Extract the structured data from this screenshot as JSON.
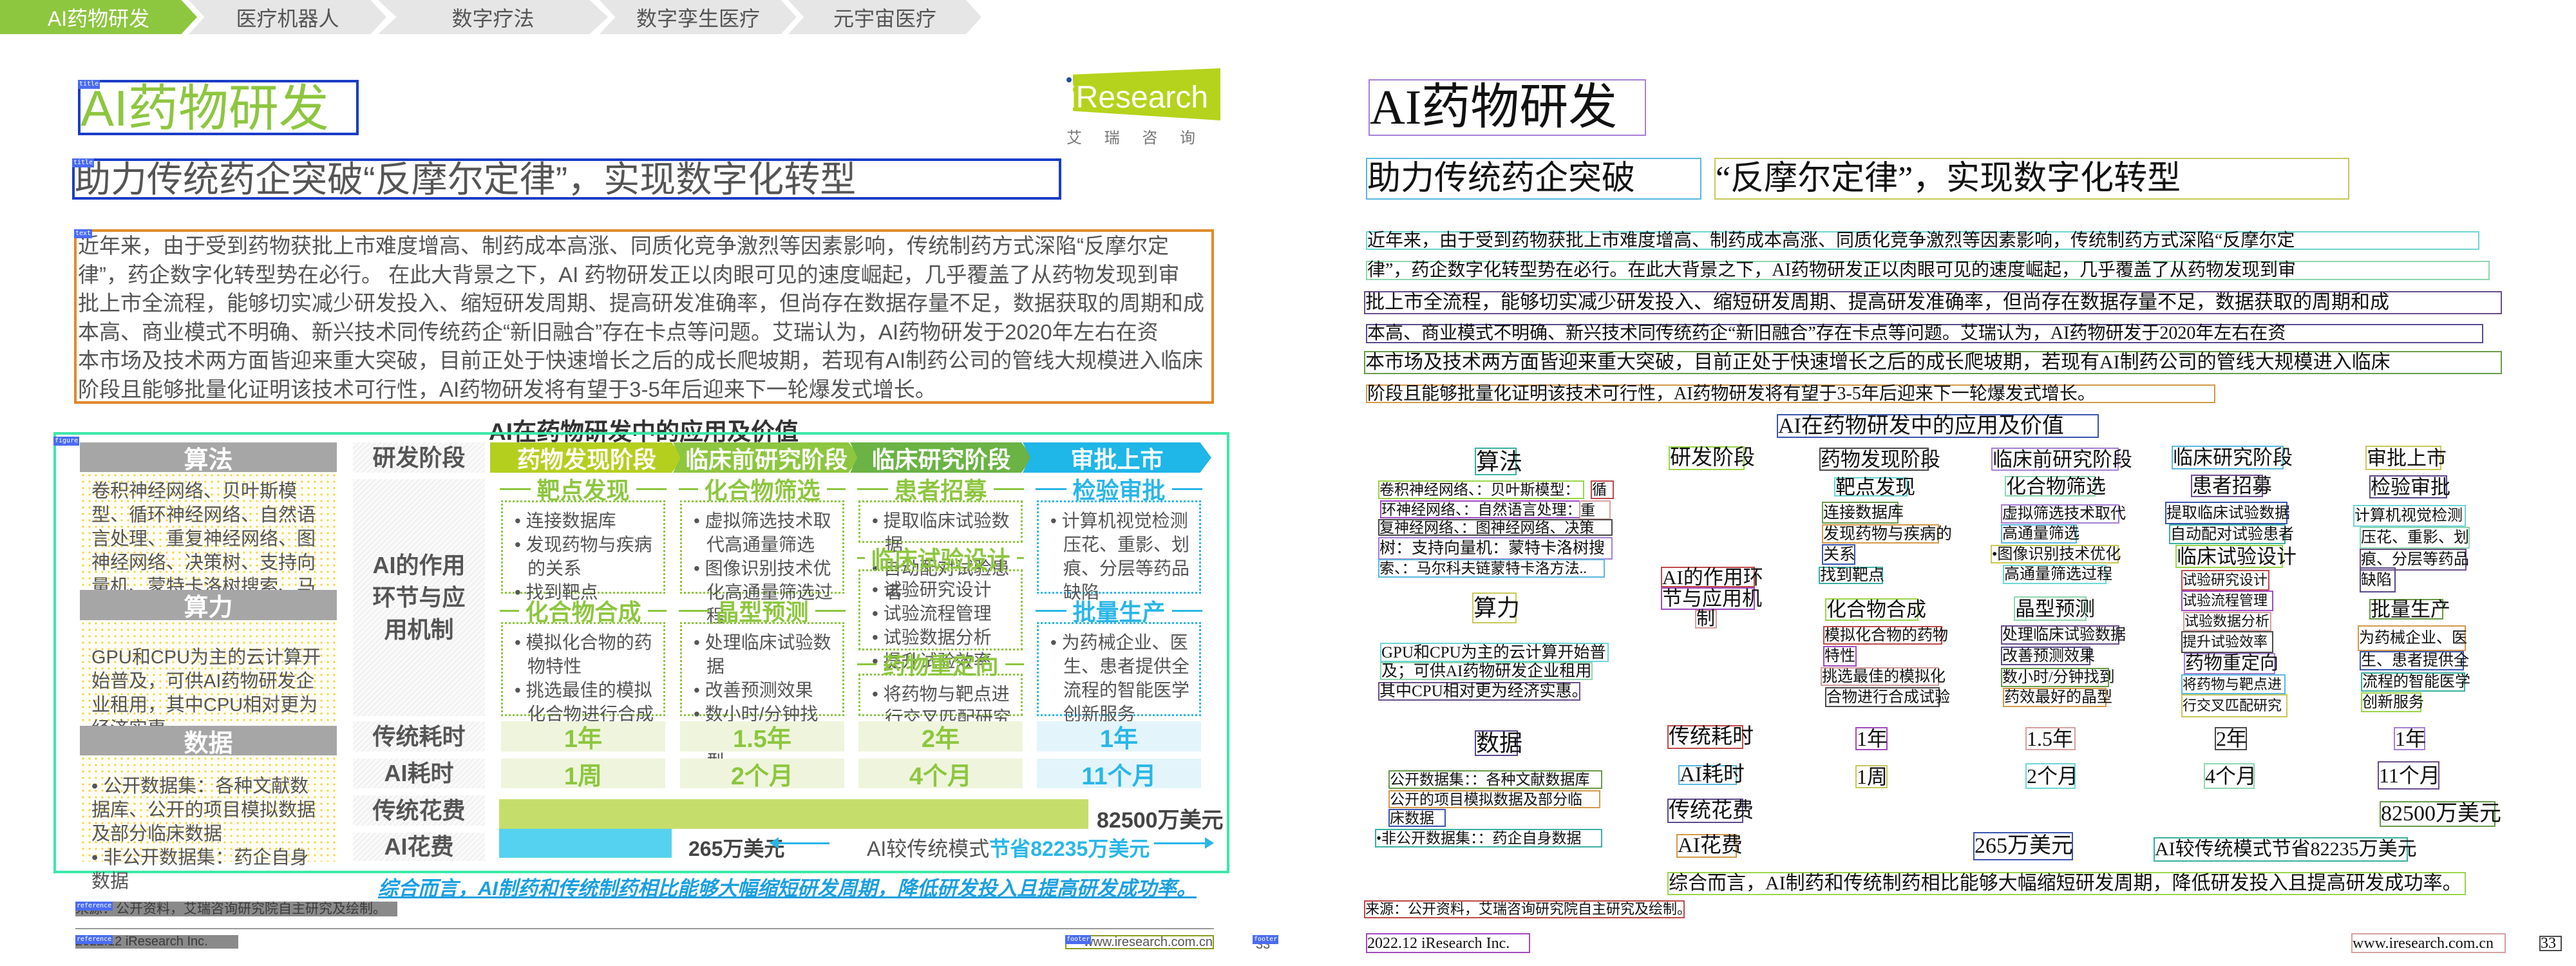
{
  "tabs": [
    "AI药物研发",
    "医疗机器人",
    "数字疗法",
    "数字孪生医疗",
    "元宇宙医疗"
  ],
  "annotation_tags": {
    "title": "title",
    "text": "text",
    "figure": "figure",
    "reference": "reference",
    "footer": "footer"
  },
  "logo": {
    "brand": "iResearch",
    "cn": "艾 瑞 咨 询"
  },
  "left": {
    "title": "AI药物研发",
    "subtitle": "助力传统药企突破“反摩尔定律”，实现数字化转型",
    "paragraph": [
      "近年来，由于受到药物获批上市难度增高、制药成本高涨、同质化竞争激烈等因素影响，传统制药方式深陷“反摩尔定",
      "律”，药企数字化转型势在必行。 在此大背景之下，AI 药物研发正以肉眼可见的速度崛起，几乎覆盖了从药物发现到审",
      "批上市全流程，能够切实减少研发投入、缩短研发周期、提高研发准确率，但尚存在数据存量不足，数据获取的周期和成",
      "本高、商业模式不明确、新兴技术同传统药企“新旧融合”存在卡点等问题。艾瑞认为，AI药物研发于2020年左右在资",
      "本市场及技术两方面皆迎来重大突破，目前正处于快速增长之后的成长爬坡期，若现有AI制药公司的管线大规模进入临床",
      "阶段且能够批量化证明该技术可行性，AI药物研发将有望于3-5年后迎来下一轮爆发式增长。"
    ],
    "chart": {
      "title": "AI在药物研发中的应用及价值",
      "sections": [
        {
          "title": "算法",
          "text": "卷积神经网络、贝叶斯模型、循环神经网络、自然语言处理、重复神经网络、图神经网络、决策树、支持向量机、蒙特卡洛树搜索、马尔科夫链蒙特卡洛方法……"
        },
        {
          "title": "算力",
          "text": "GPU和CPU为主的云计算开始普及，可供AI药物研发企业租用，其中CPU相对更为经济实惠。"
        },
        {
          "title": "数据",
          "bullets": [
            "公开数据集：各种文献数据库、公开的项目模拟数据及部分临床数据",
            "非公开数据集：药企自身数据"
          ]
        }
      ],
      "row_labels": {
        "stage": "研发阶段",
        "role": "AI的作用环节与应用机制",
        "trad_time": "传统耗时",
        "ai_time": "AI耗时",
        "trad_cost": "传统花费",
        "ai_cost": "AI花费"
      },
      "stages": [
        "药物发现阶段",
        "临床前研究阶段",
        "临床研究阶段",
        "审批上市"
      ],
      "columns": [
        {
          "groups": [
            {
              "heading": "靶点发现",
              "items": [
                "连接数据库",
                "发现药物与疾病的关系",
                "找到靶点"
              ]
            },
            {
              "heading": "化合物合成",
              "items": [
                "模拟化合物的药物特性",
                "挑选最佳的模拟化合物进行合成试验"
              ]
            }
          ]
        },
        {
          "groups": [
            {
              "heading": "化合物筛选",
              "items": [
                "虚拟筛选技术取代高通量筛选",
                "图像识别技术优化高通量筛选过程"
              ]
            },
            {
              "heading": "晶型预测",
              "items": [
                "处理临床试验数据",
                "改善预测效果",
                "数小时/分钟找到药效最好的晶型"
              ]
            }
          ]
        },
        {
          "groups": [
            {
              "heading": "患者招募",
              "items": [
                "提取临床试验数据",
                "自动配对试验患者"
              ]
            },
            {
              "heading": "临床试验设计",
              "items": [
                "试验研究设计",
                "试验流程管理",
                "试验数据分析",
                "提升试验效率"
              ]
            },
            {
              "heading": "药物重定向",
              "items": [
                "将药物与靶点进行交叉匹配研究"
              ]
            }
          ]
        },
        {
          "groups": [
            {
              "heading": "检验审批",
              "items": [
                "计算机视觉检测压花、重影、划痕、分层等药品缺陷"
              ]
            },
            {
              "heading": "批量生产",
              "items": [
                "为药械企业、医生、患者提供全流程的智能医学创新服务"
              ]
            }
          ]
        }
      ],
      "trad_time": [
        "1年",
        "1.5年",
        "2年",
        "1年"
      ],
      "ai_time": [
        "1周",
        "2个月",
        "4个月",
        "11个月"
      ],
      "trad_cost": "82500万美元",
      "ai_cost": "265万美元",
      "savings_prefix": "AI较传统模式",
      "savings_value": "节省82235万美元",
      "trad_cost_value": 82500,
      "ai_cost_value": 265
    },
    "conclusion": "综合而言，AI制药和传统制药相比能够大幅缩短研发周期，降低研发投入且提高研发成功率。",
    "source": "来源：公开资料，艾瑞咨询研究院自主研究及绘制。",
    "footer_left": "2022.12 iResearch Inc.",
    "footer_right": "www.iresearch.com.cn",
    "page": "33"
  },
  "right": {
    "title": "AI药物研发",
    "subtitle": [
      "助力传统药企突破",
      "“反摩尔定律”，实现数字化转型"
    ],
    "paragraph": [
      "近年来，由于受到药物获批上市难度增高、制药成本高涨、同质化竞争激烈等因素影响，传统制药方式深陷“反摩尔定",
      "律”，药企数字化转型势在必行。在此大背景之下，AI药物研发正以肉眼可见的速度崛起，几乎覆盖了从药物发现到审",
      "批上市全流程，能够切实减少研发投入、缩短研发周期、提高研发准确率，但尚存在数据存量不足，数据获取的周期和成",
      "本高、商业模式不明确、新兴技术同传统药企“新旧融合”存在卡点等问题。艾瑞认为，AI药物研发于2020年左右在资",
      "本市场及技术两方面皆迎来重大突破，目前正处于快速增长之后的成长爬坡期，若现有AI制药公司的管线大规模进入临床",
      "阶段且能够批量化证明该技术可行性，AI药物研发将有望于3-5年后迎来下一轮爆发式增长。"
    ],
    "chart_title": "AI在药物研发中的应用及价值",
    "algo_title": "算法",
    "algo": [
      "卷积神经网络、：贝叶斯模型：",
      "循",
      "环神经网络、：自然语言处理：",
      "重",
      "复神经网络、：图神经网络、决策",
      "树：支持向量机：蒙特卡洛树搜",
      "索、：马尔科夫链蒙特卡洛方法.."
    ],
    "compute_title": "算力",
    "compute": [
      "GPU和CPU为主的云计算开始普",
      "及；可供AI药物研发企业租用",
      "其中CPU相对更为经济实惠。"
    ],
    "data_title": "数据",
    "data": [
      "公开数据集：：各种文献数据库",
      "公开的项目模拟数据及部分临",
      "床数据",
      "•非公开数据集：：药企自身数据"
    ],
    "stage_label": "研发阶段",
    "role_label": [
      "AI的作用环",
      "节与应用机",
      "制"
    ],
    "stages": [
      "药物发现阶段",
      "临床前研究阶段",
      "临床研究阶段",
      "审批上市"
    ],
    "headings": [
      "靶点发现",
      "化合物筛选",
      "患者招募",
      "检验审批"
    ],
    "col1": [
      "连接数据库",
      "发现药物与疾病的",
      "关系",
      "找到靶点",
      "化合物合成",
      "模拟化合物的药物",
      "特性",
      "挑选最佳的模拟化",
      "合物进行合成试验"
    ],
    "col2": [
      "虚拟筛选技术取代",
      "高通量筛选",
      "•图像识别技术优化",
      "高通量筛选过程",
      "晶型预测",
      "处理临床试验数据",
      "改善预测效果",
      "数小时/分钟找到",
      "药效最好的晶型"
    ],
    "col3": [
      "提取临床试验数据",
      "自动配对试验患者",
      "临床试验设计",
      "试验研究设计",
      "试验流程管理",
      "试验数据分析",
      "提升试验效率",
      "药物重定向",
      "将药物与靶点进",
      "行交叉匹配研究"
    ],
    "col4": [
      "计算机视觉检测",
      "压花、重影、划",
      "痕、分层等药品",
      "缺陷",
      "批量生产",
      "为药械企业、医",
      "生、患者提供全",
      "流程的智能医学",
      "创新服务"
    ],
    "trad_time_label": "传统耗时",
    "trad_time": [
      "1年",
      "1.5年",
      "2年",
      "1年"
    ],
    "ai_time_label": "AI耗时",
    "ai_time": [
      "1周",
      "2个月",
      "4个月",
      "11个月"
    ],
    "trad_cost_label": "传统花费",
    "trad_cost": "82500万美元",
    "ai_cost_label": "AI花费",
    "ai_cost": "265万美元",
    "savings": "AI较传统模式节省82235万美元",
    "conclusion": "综合而言，AI制药和传统制药相比能够大幅缩短研发周期，降低研发投入且提高研发成功率。",
    "source": "来源：公开资料，艾瑞咨询研究院自主研究及绘制。",
    "footer_left": "2022.12 iResearch Inc.",
    "footer_right": "www.iresearch.com.cn",
    "page": "33"
  }
}
